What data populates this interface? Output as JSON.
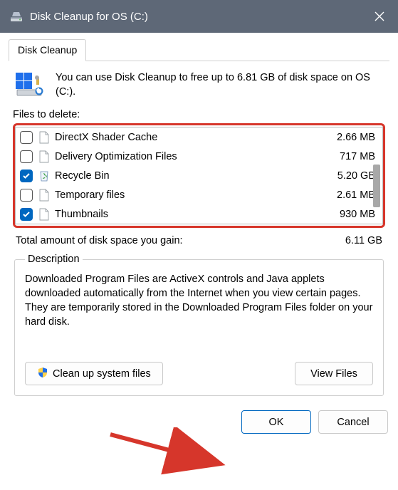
{
  "window": {
    "title": "Disk Cleanup for OS (C:)"
  },
  "tabs": [
    {
      "label": "Disk Cleanup"
    }
  ],
  "intro": {
    "text": "You can use Disk Cleanup to free up to 6.81 GB of disk space on OS (C:)."
  },
  "files_section_label": "Files to delete:",
  "files": [
    {
      "checked": false,
      "icon": "file",
      "name": "DirectX Shader Cache",
      "size": "2.66 MB"
    },
    {
      "checked": false,
      "icon": "file",
      "name": "Delivery Optimization Files",
      "size": "717 MB"
    },
    {
      "checked": true,
      "icon": "recycle",
      "name": "Recycle Bin",
      "size": "5.20 GB"
    },
    {
      "checked": false,
      "icon": "file",
      "name": "Temporary files",
      "size": "2.61 MB"
    },
    {
      "checked": true,
      "icon": "file",
      "name": "Thumbnails",
      "size": "930 MB"
    }
  ],
  "total": {
    "label": "Total amount of disk space you gain:",
    "value": "6.11 GB"
  },
  "description": {
    "legend": "Description",
    "text": "Downloaded Program Files are ActiveX controls and Java applets downloaded automatically from the Internet when you view certain pages. They are temporarily stored in the Downloaded Program Files folder on your hard disk."
  },
  "buttons": {
    "clean_system": "Clean up system files",
    "view_files": "View Files",
    "ok": "OK",
    "cancel": "Cancel"
  }
}
